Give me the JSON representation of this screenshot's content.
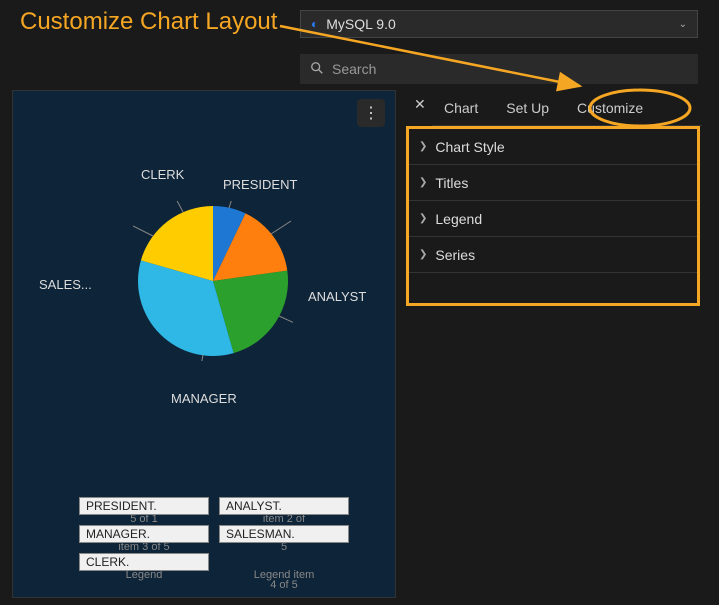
{
  "annotation": {
    "title": "Customize Chart Layout"
  },
  "connection": {
    "label": "MySQL 9.0"
  },
  "search": {
    "placeholder": "Search"
  },
  "tabs": {
    "chart": "Chart",
    "setup": "Set Up",
    "customize": "Customize"
  },
  "sections": {
    "chart_style": "Chart Style",
    "titles": "Titles",
    "legend": "Legend",
    "series": "Series"
  },
  "chart_data": {
    "type": "pie",
    "title": "",
    "series": [
      {
        "name": "PRESIDENT",
        "value": 1,
        "color": "#1f77d4"
      },
      {
        "name": "ANALYST",
        "value": 2,
        "color": "#ff7f0e"
      },
      {
        "name": "MANAGER",
        "value": 3,
        "color": "#2ca02c"
      },
      {
        "name": "SALESMAN",
        "value": 4,
        "color": "#2fb8e6",
        "display_label": "SALES..."
      },
      {
        "name": "CLERK",
        "value": 4,
        "color": "#ffcc00"
      }
    ],
    "legend_items": [
      "PRESIDENT.",
      "ANALYST.",
      "MANAGER.",
      "SALESMAN.",
      "CLERK."
    ],
    "legend_captions": {
      "c1": "5 of 1",
      "c2": "item 2 of",
      "c3": "item 3 of 5",
      "c4": "5",
      "c5": "Legend",
      "c6": "Legend item",
      "c7": "4 of 5"
    }
  }
}
